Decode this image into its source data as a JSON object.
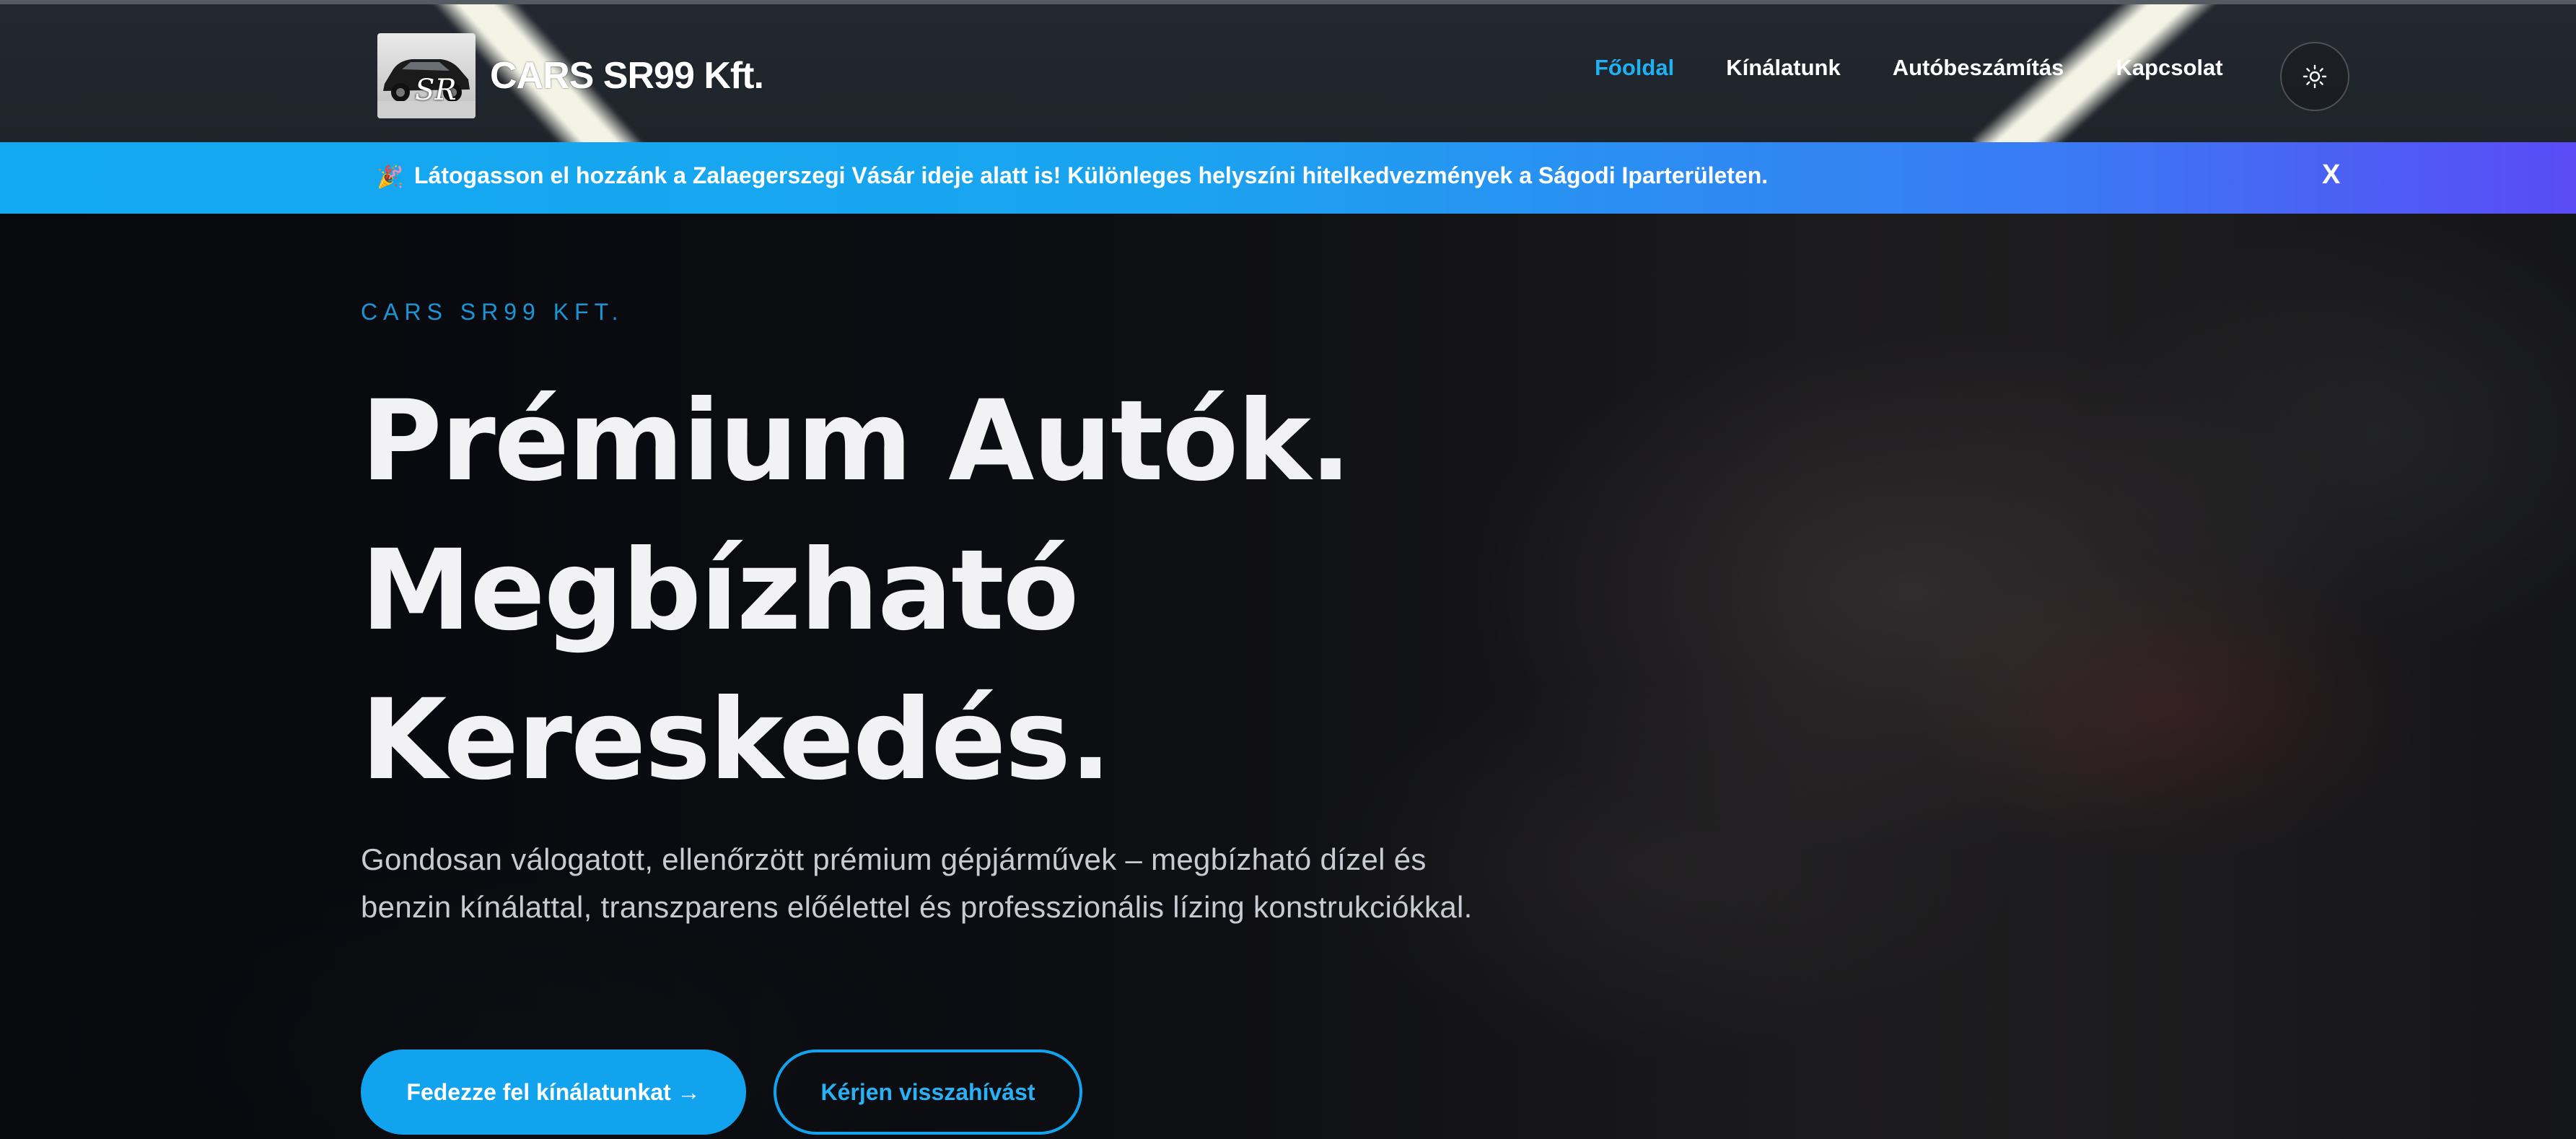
{
  "header": {
    "brand_name": "CARS SR99 Kft.",
    "logo_letters": "SR",
    "nav": [
      {
        "label": "Főoldal",
        "active": true
      },
      {
        "label": "Kínálatunk",
        "active": false
      },
      {
        "label": "Autóbeszámítás",
        "active": false
      },
      {
        "label": "Kapcsolat",
        "active": false
      }
    ],
    "theme_toggle_icon": "sun-icon"
  },
  "announcement": {
    "icon": "party-popper-icon",
    "emoji": "🎉",
    "text": "Látogasson el hozzánk a Zalaegerszegi Vásár ideje alatt is! Különleges helyszíni hitelkedvezmények a Ságodi Iparterületen.",
    "close_label": "X"
  },
  "hero": {
    "eyebrow": "CARS SR99 KFT.",
    "headline_lines": [
      "Prémium Autók.",
      "Megbízható",
      "Kereskedés."
    ],
    "subtext": "Gondosan válogatott, ellenőrzött prémium gépjárművek – megbízható dízel és benzin kínálattal, transzparens előélettel és professzionális lízing konstrukciókkal.",
    "cta_primary": "Fedezze fel kínálatunkat →",
    "cta_secondary": "Kérjen visszahívást"
  },
  "colors": {
    "accent": "#12a3ef",
    "active_nav": "#1fb1f2",
    "announcement_gradient_start": "#12a9f1",
    "announcement_gradient_end": "#5a4bf5",
    "headline": "#f2f2f4"
  }
}
